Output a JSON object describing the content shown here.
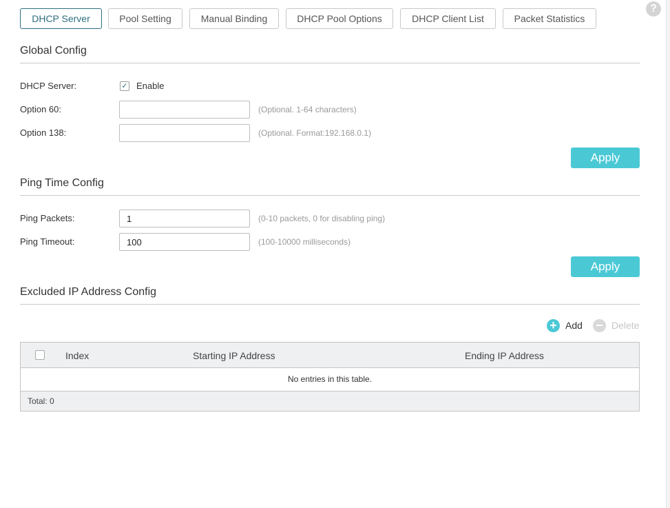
{
  "help_symbol": "?",
  "tabs": [
    {
      "label": "DHCP Server",
      "active": true
    },
    {
      "label": "Pool Setting",
      "active": false
    },
    {
      "label": "Manual Binding",
      "active": false
    },
    {
      "label": "DHCP Pool Options",
      "active": false
    },
    {
      "label": "DHCP Client List",
      "active": false
    },
    {
      "label": "Packet Statistics",
      "active": false
    }
  ],
  "global_config": {
    "title": "Global Config",
    "dhcp_server_label": "DHCP Server:",
    "enable_label": "Enable",
    "enable_checked": true,
    "check_glyph": "✓",
    "option60_label": "Option 60:",
    "option60_value": "",
    "option60_hint": "(Optional. 1-64 characters)",
    "option138_label": "Option 138:",
    "option138_value": "",
    "option138_hint": "(Optional. Format:192.168.0.1)",
    "apply_label": "Apply"
  },
  "ping_config": {
    "title": "Ping Time Config",
    "packets_label": "Ping Packets:",
    "packets_value": "1",
    "packets_hint": "(0-10 packets, 0 for disabling ping)",
    "timeout_label": "Ping Timeout:",
    "timeout_value": "100",
    "timeout_hint": "(100-10000 milliseconds)",
    "apply_label": "Apply"
  },
  "excluded_config": {
    "title": "Excluded IP Address Config",
    "add_label": "Add",
    "delete_label": "Delete",
    "add_symbol": "+",
    "delete_symbol": "−",
    "table": {
      "columns": [
        "Index",
        "Starting IP Address",
        "Ending IP Address"
      ],
      "empty_message": "No entries in this table.",
      "total_label": "Total: 0"
    }
  },
  "colors": {
    "accent": "#4ac9d5",
    "active_tab": "#2d6e7e",
    "disabled": "#c7c7c7"
  }
}
